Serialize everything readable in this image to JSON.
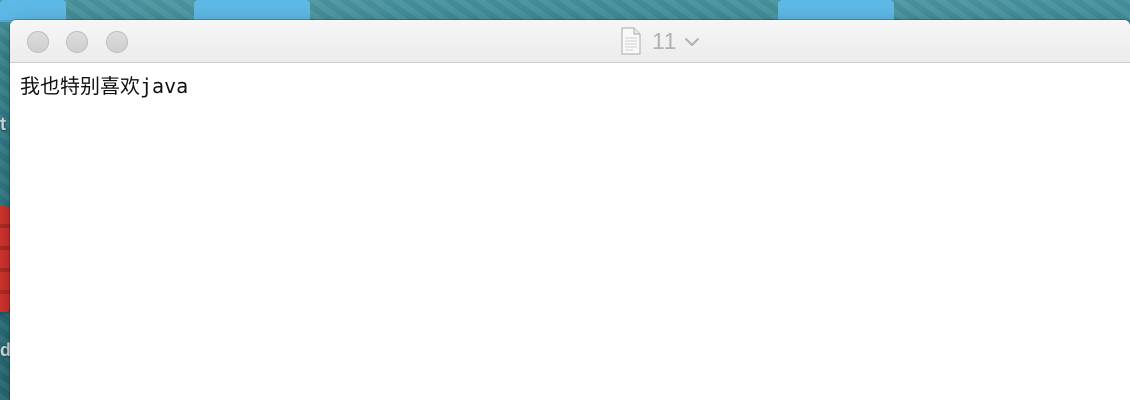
{
  "desktop": {
    "left_edge_letters": [
      "t",
      "d"
    ]
  },
  "window": {
    "title": "11",
    "icons": {
      "document": "document-icon",
      "title_menu": "chevron-down-icon",
      "close": "close-button",
      "minimize": "minimize-button",
      "zoom": "zoom-button"
    }
  },
  "document": {
    "text": "我也特别喜欢java"
  },
  "colors": {
    "window_background": "#ffffff",
    "titlebar_background": "#ececec",
    "title_text": "#b2b2b2",
    "desktop_tabs": "#5fb9e6"
  }
}
